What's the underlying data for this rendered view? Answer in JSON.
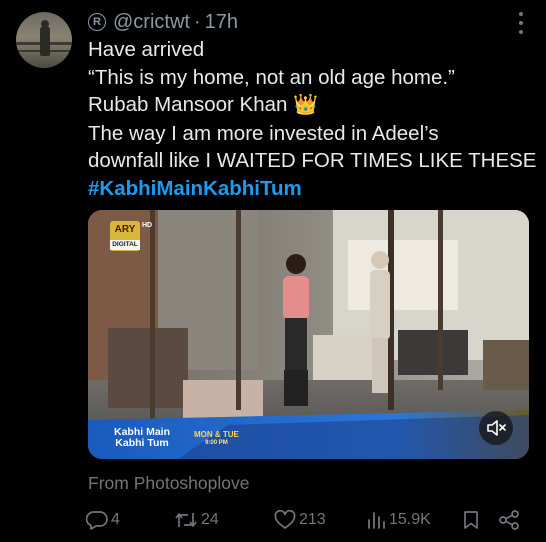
{
  "post": {
    "handle": "@crictwt",
    "dot": "·",
    "time": "17h",
    "lines": [
      "Have arrived",
      "“This is my home, not an old age home.”",
      "Rubab Mansoor Khan ",
      "The way I am more invested in Adeel’s",
      "downfall like I WAITED FOR TIMES LIKE THESE"
    ],
    "crown_emoji": "👑",
    "hashtag": "#KabhiMainKabhiTum",
    "source": "From Photoshoplove"
  },
  "media": {
    "channel_logo": "ARY",
    "channel_sub": "DIGITAL",
    "hd_mark": "HD",
    "show_title_line1": "Kabhi Main",
    "show_title_line2": "Kabhi Tum",
    "days": "MON & TUE",
    "airtime": "9:00 PM"
  },
  "metrics": {
    "replies": "4",
    "reposts": "24",
    "likes": "213",
    "views": "15.9K"
  },
  "colors": {
    "accent": "#1d9bf0",
    "muted": "#71767b",
    "text": "#e7e9ea",
    "background": "#000000"
  },
  "icons": [
    "registered-icon",
    "more-icon",
    "reply-icon",
    "repost-icon",
    "like-icon",
    "views-icon",
    "bookmark-icon",
    "share-icon",
    "mute-icon"
  ]
}
